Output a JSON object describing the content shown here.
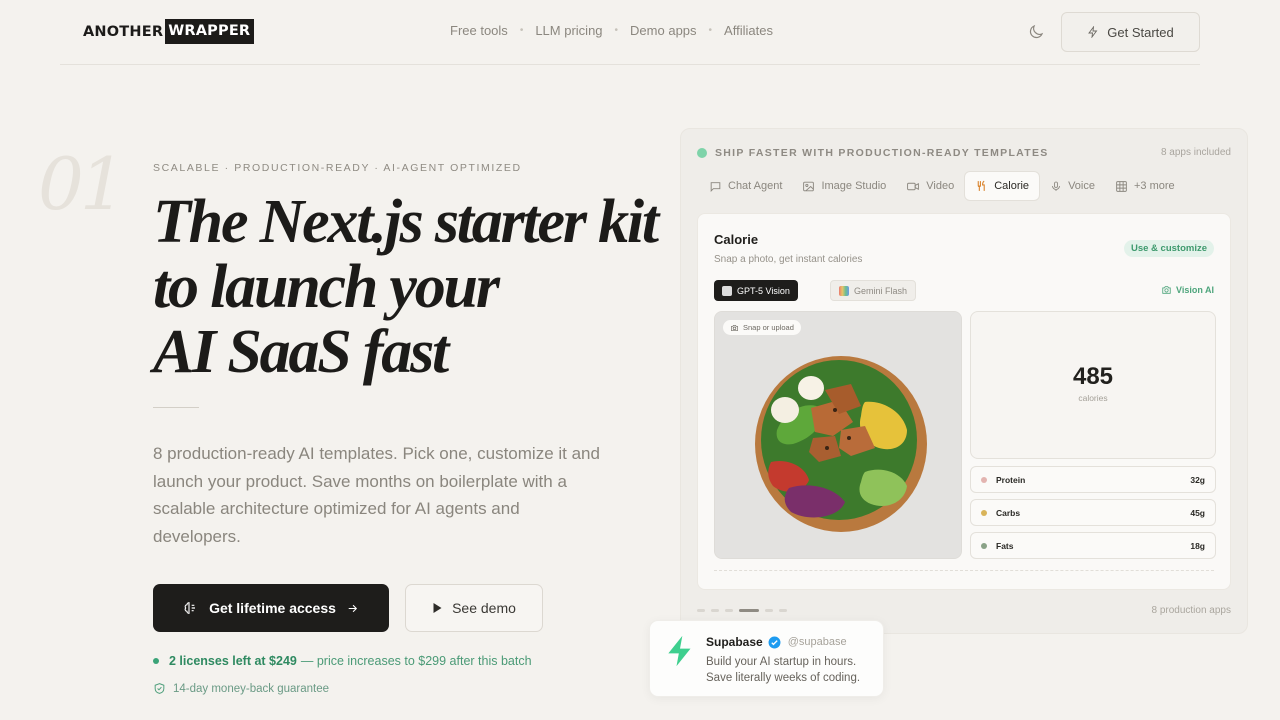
{
  "header": {
    "logo_part1": "ANOTHER",
    "logo_part2": "WRAPPER",
    "nav": [
      "Free tools",
      "LLM pricing",
      "Demo apps",
      "Affiliates"
    ],
    "theme_icon": "moon-icon",
    "cta_label": "Get Started",
    "cta_icon": "lightning-icon"
  },
  "hero": {
    "index_number": "01",
    "eyebrow": "SCALABLE · PRODUCTION-READY · AI-AGENT OPTIMIZED",
    "headline_lines": [
      "The Next.js starter kit",
      "to launch your",
      "AI SaaS fast"
    ],
    "description": "8 production-ready AI templates. Pick one, customize it and launch your product. Save months on boilerplate with a scalable architecture optimized for AI agents and developers.",
    "primary_button": "Get lifetime access",
    "secondary_button": "See demo",
    "licenses_bold": "2 licenses left at $249",
    "licenses_rest": "— price increases to $299 after this batch",
    "guarantee": "14-day money-back guarantee"
  },
  "panel": {
    "heading": "SHIP FASTER WITH PRODUCTION-READY TEMPLATES",
    "apps_included": "8 apps included",
    "tabs": [
      {
        "label": "Chat Agent",
        "icon": "chat-icon"
      },
      {
        "label": "Image Studio",
        "icon": "image-icon"
      },
      {
        "label": "Video",
        "icon": "video-icon"
      },
      {
        "label": "Calorie",
        "icon": "fork-knife-icon",
        "active": true
      },
      {
        "label": "Voice",
        "icon": "mic-icon"
      },
      {
        "label": "+3 more",
        "icon": "grid-icon"
      }
    ],
    "card": {
      "title": "Calorie",
      "subtitle": "Snap a photo, get instant calories",
      "badge": "Use & customize",
      "models": [
        "GPT-5 Vision",
        "Gemini Flash"
      ],
      "vision_label": "Vision AI",
      "snap_label": "Snap or upload",
      "calories_value": "485",
      "calories_label": "calories",
      "macros": [
        {
          "name": "Protein",
          "value": "32g",
          "color": "#e3b4b0"
        },
        {
          "name": "Carbs",
          "value": "45g",
          "color": "#d9b45a"
        },
        {
          "name": "Fats",
          "value": "18g",
          "color": "#8aa287"
        }
      ]
    },
    "footer_label": "8 production apps"
  },
  "testimonial": {
    "name": "Supabase",
    "handle": "@supabase",
    "quote": "Build your AI startup in hours. Save literally weeks of coding."
  },
  "colors": {
    "accent_green": "#3aa377",
    "dark": "#1e1d1b",
    "background": "#f4f2ee"
  }
}
